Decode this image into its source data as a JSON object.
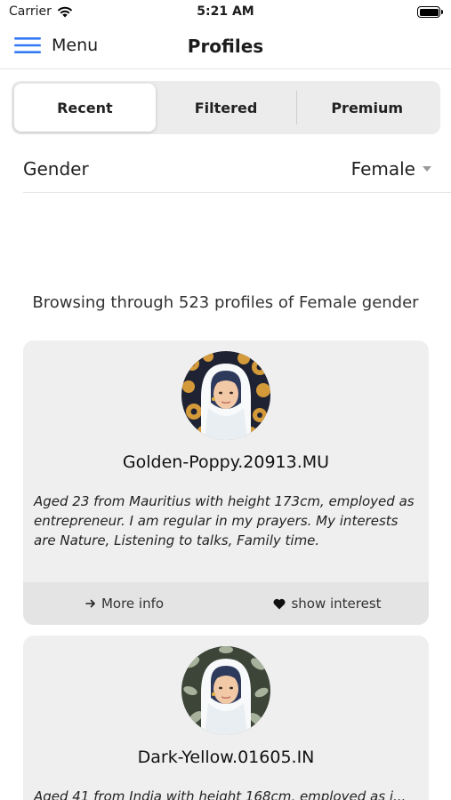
{
  "status_bar": {
    "carrier": "Carrier",
    "time": "5:21 AM"
  },
  "nav": {
    "menu_label": "Menu",
    "title": "Profiles"
  },
  "segments": [
    {
      "label": "Recent",
      "active": true
    },
    {
      "label": "Filtered",
      "active": false
    },
    {
      "label": "Premium",
      "active": false
    }
  ],
  "gender": {
    "label": "Gender",
    "value": "Female"
  },
  "browse_text": "Browsing through 523 profiles of Female gender",
  "profiles": [
    {
      "name": "Golden-Poppy.20913.MU",
      "description": "Aged 23  from Mauritius with height 173cm, employed as entrepreneur. I am regular in my prayers. My interests are Nature, Listening to talks, Family time.",
      "more_info_label": "More info",
      "interest_label": "show interest",
      "avatar_bg": "#1f2233",
      "avatar_pattern": "#d49a3a"
    },
    {
      "name": "Dark-Yellow.01605.IN",
      "description": "Aged 41  from India with height 168cm, employed as i...",
      "avatar_bg": "#3d4538",
      "avatar_pattern": "#a7b29c"
    }
  ],
  "colors": {
    "accent": "#3478f6",
    "card_bg": "#efefef",
    "card_footer": "#e4e4e4"
  }
}
